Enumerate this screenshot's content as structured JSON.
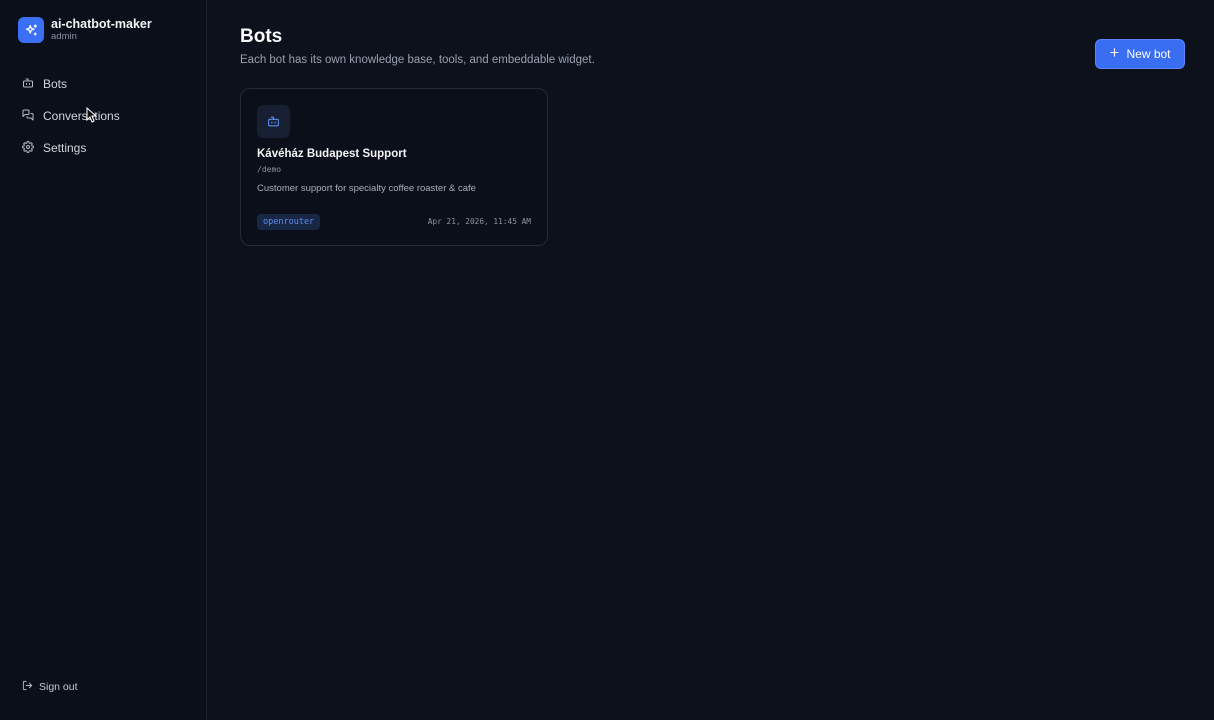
{
  "sidebar": {
    "brand_name": "ai-chatbot-maker",
    "brand_role": "admin",
    "brand_icon": "sparkles-icon",
    "items": [
      {
        "label": "Bots",
        "icon": "bot-icon"
      },
      {
        "label": "Conversations",
        "icon": "chat-bubbles-icon"
      },
      {
        "label": "Settings",
        "icon": "gear-icon"
      }
    ],
    "signout_label": "Sign out",
    "signout_icon": "logout-icon"
  },
  "header": {
    "title": "Bots",
    "subtitle": "Each bot has its own knowledge base, tools, and embeddable widget.",
    "new_bot_label": "New bot"
  },
  "bots": [
    {
      "name": "Kávéház Budapest Support",
      "slug": "/demo",
      "description": "Customer support for specialty coffee roaster & cafe",
      "provider": "openrouter",
      "date": "Apr 21, 2026, 11:45 AM"
    }
  ],
  "colors": {
    "accent": "#3b6ff5",
    "background": "#0d111b",
    "sidebar": "#0b0f1a",
    "badge_text": "#5b8cf2"
  }
}
